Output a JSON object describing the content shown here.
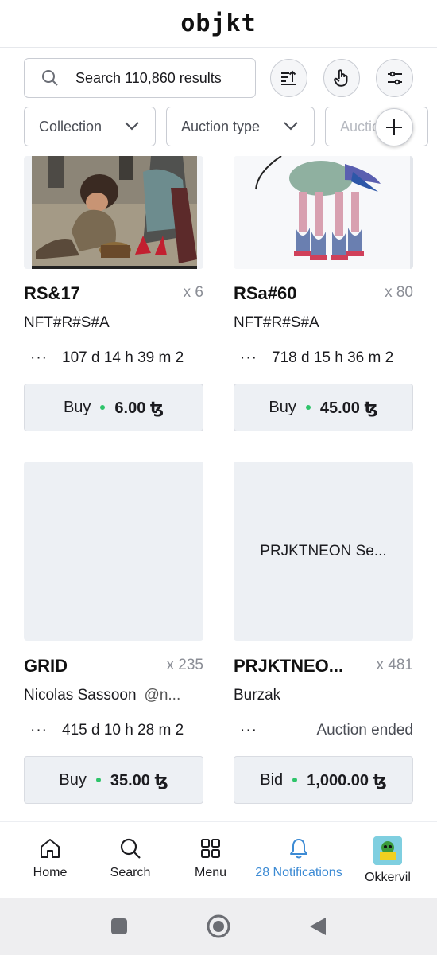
{
  "app": {
    "logo": "objkt"
  },
  "search": {
    "placeholder": "Search 110,860 results"
  },
  "toolbar": {
    "sort_icon": "sort-icon",
    "touch_icon": "touch-icon",
    "filter_icon": "sliders-icon"
  },
  "filters": [
    {
      "label": "Collection"
    },
    {
      "label": "Auction type"
    },
    {
      "label": "Auction"
    }
  ],
  "cards": [
    {
      "title": "RS&17",
      "edition": "x 6",
      "artist": "NFT#R#S#A",
      "time": "107 d  14 h  39 m  2",
      "action": "Buy",
      "price": "6.00 ꜩ"
    },
    {
      "title": "RSa#60",
      "edition": "x 80",
      "artist": "NFT#R#S#A",
      "time": "718 d  15 h  36 m  2",
      "action": "Buy",
      "price": "45.00 ꜩ"
    },
    {
      "title": "GRID",
      "edition": "x 235",
      "artist": "Nicolas Sassoon",
      "handle": "@n...",
      "time": "415 d  10 h  28 m  2",
      "action": "Buy",
      "price": "35.00 ꜩ"
    },
    {
      "title": "PRJKTNEO...",
      "edition": "x 481",
      "artist": "Burzak",
      "thumb_text": "PRJKTNEON Se...",
      "status": "Auction ended",
      "action": "Bid",
      "price": "1,000.00 ꜩ"
    }
  ],
  "nav": {
    "home": "Home",
    "search": "Search",
    "menu": "Menu",
    "notifications": "28 Notifications",
    "profile": "Okkervil"
  },
  "colors": {
    "accent": "#3d8bd4",
    "price_dot": "#2ec46a",
    "button_bg": "#edf0f4"
  }
}
